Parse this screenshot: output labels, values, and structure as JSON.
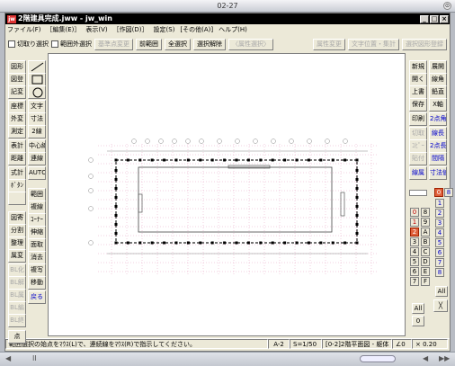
{
  "outer": {
    "title": "02-27",
    "corner": "⊙"
  },
  "window": {
    "logo": "jw",
    "title": "2階建具完成.jww - jw_win",
    "caption": {
      "min": "_",
      "max": "□",
      "close": "×"
    }
  },
  "menu": [
    "ファイル(F)",
    "［編集(E)］",
    "表示(V)",
    "［作図(D)］",
    "設定(S)",
    "[その他(A)]",
    "ヘルプ(H)"
  ],
  "options": {
    "cut_select": "切取り選択",
    "out_select": "範囲外選択",
    "buttons": [
      "基準点変更",
      "前範囲",
      "全選択",
      "選択解除",
      "〈属性選択〉"
    ],
    "disabled": [
      true,
      false,
      false,
      false,
      true
    ],
    "right_buttons": [
      "属性変更",
      "文字位置・集計",
      "選択図形登録"
    ]
  },
  "left_tools": [
    {
      "label": "図形",
      "blue": false
    },
    {
      "label": "図登",
      "blue": false
    },
    {
      "label": "記変",
      "blue": false
    },
    {
      "label": "座標",
      "blue": false
    },
    {
      "label": "外変",
      "blue": false
    },
    {
      "label": "測定",
      "blue": false
    },
    {
      "label": "表計",
      "blue": false
    },
    {
      "label": "距離",
      "blue": false
    },
    {
      "label": "式計",
      "blue": false
    },
    {
      "label": "ﾎﾞﾀﾝ",
      "blue": false
    },
    {
      "label": "",
      "blue": false
    },
    {
      "label": "図寄",
      "blue": false
    },
    {
      "label": "分割",
      "blue": false
    },
    {
      "label": "整理",
      "blue": false
    },
    {
      "label": "属変",
      "blue": false
    },
    {
      "label": "BL化",
      "blue": false
    },
    {
      "label": "BL解",
      "blue": false
    },
    {
      "label": "BL属",
      "blue": false
    },
    {
      "label": "BL編",
      "blue": false
    },
    {
      "label": "BL終",
      "blue": false
    },
    {
      "label": "点",
      "blue": false
    }
  ],
  "left_tools2": [
    {
      "label": "文字"
    },
    {
      "label": "寸法"
    },
    {
      "label": "2線"
    },
    {
      "label": "中心線"
    },
    {
      "label": "連線"
    },
    {
      "label": "AUTO"
    },
    {
      "label": "範囲"
    },
    {
      "label": "複線"
    },
    {
      "label": "ｺｰﾅｰ"
    },
    {
      "label": "伸縮"
    },
    {
      "label": "面取"
    },
    {
      "label": "消去"
    },
    {
      "label": "複写"
    },
    {
      "label": "移動"
    },
    {
      "label": "戻る"
    }
  ],
  "right_tools": [
    {
      "a": "新規",
      "b": "展開"
    },
    {
      "a": "開く",
      "b": "線角"
    },
    {
      "a": "上書",
      "b": "鉛直"
    },
    {
      "a": "保存",
      "b": "X軸"
    },
    {
      "a": "印刷",
      "b": "2点角"
    },
    {
      "a": "切取",
      "b": "線長"
    },
    {
      "a": "ｺﾋﾟｰ",
      "b": "2点長"
    },
    {
      "a": "貼付",
      "b": "間隔"
    },
    {
      "a": "線属",
      "b": "寸法値"
    }
  ],
  "layers": {
    "groups": [
      "0",
      "1",
      "2",
      "3",
      "4",
      "5",
      "6",
      "7"
    ],
    "layers_a": [
      "8",
      "9",
      "A",
      "B",
      "C",
      "D",
      "E",
      "F"
    ],
    "layers_b": [
      "0",
      "1",
      "2",
      "3",
      "4",
      "5",
      "6",
      "7",
      "8",
      "9",
      "A",
      "B",
      "C",
      "D",
      "E",
      "F"
    ],
    "all": "All",
    "zero": "0",
    "cross": "╳"
  },
  "status": {
    "message": "範囲選択の始点をﾏｳｽ(L)で、連続線をﾏｳｽ(R)で指示してください。",
    "paper": "A-2",
    "scale": "S=1/50",
    "layer": "[0-2]2階平面図 - 躯体",
    "angle": "∠0",
    "zoom": "× 0.20"
  },
  "scroll": {
    "left": "◀",
    "pgleft": "II",
    "pgright": "◀",
    "right": "▶▶"
  }
}
